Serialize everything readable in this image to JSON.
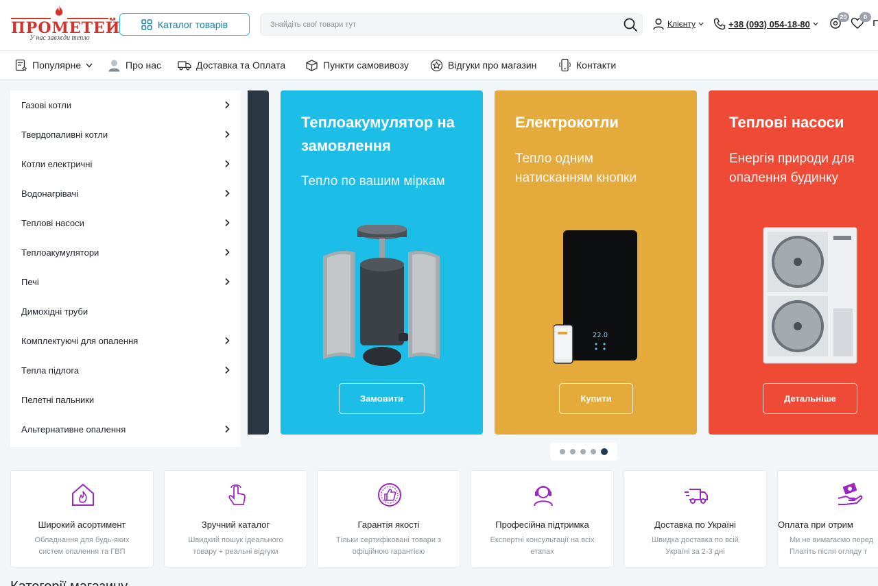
{
  "header": {
    "logo_brand": "ПРОМЕТЕЙ",
    "logo_tagline": "У нас завжди тепло",
    "catalog_button": "Каталог товарів",
    "search_placeholder": "Знайдіть свої товари тут",
    "client_label": "Клієнту",
    "phone": "+38 (093) 054-18-80",
    "compare_count": "20",
    "wishlist_count": "0"
  },
  "nav": {
    "items": [
      {
        "label": "Популярне",
        "icon": "star-list-icon"
      },
      {
        "label": "Про нас",
        "icon": "person-icon"
      },
      {
        "label": "Доставка та Оплата",
        "icon": "truck-icon"
      },
      {
        "label": "Пункти самовивозу",
        "icon": "box-icon"
      },
      {
        "label": "Відгуки про магазин",
        "icon": "star-badge-icon"
      },
      {
        "label": "Контакти",
        "icon": "phone-icon"
      }
    ]
  },
  "sidebar": {
    "items": [
      {
        "label": "Газові котли",
        "has_sub": true
      },
      {
        "label": "Твердопаливні котли",
        "has_sub": true
      },
      {
        "label": "Котли електричні",
        "has_sub": true
      },
      {
        "label": "Водонагрівачі",
        "has_sub": true
      },
      {
        "label": "Теплові насоси",
        "has_sub": true
      },
      {
        "label": "Теплоакумулятори",
        "has_sub": true
      },
      {
        "label": "Печі",
        "has_sub": true
      },
      {
        "label": "Димохідні труби",
        "has_sub": false
      },
      {
        "label": "Комплектуючі для опалення",
        "has_sub": true
      },
      {
        "label": "Тепла підлога",
        "has_sub": true
      },
      {
        "label": "Пелетні пальники",
        "has_sub": false
      },
      {
        "label": "Альтернативне опалення",
        "has_sub": true
      }
    ]
  },
  "banners": [
    {
      "title_line1": "Теплоакумулятор на",
      "title_line2": "замовлення",
      "subtitle_line1": "Тепло по вашим міркам",
      "subtitle_line2": "",
      "button": "Замовити",
      "color": "#1cbde6"
    },
    {
      "title_line1": "Електрокотли",
      "title_line2": "",
      "subtitle_line1": "Тепло одним",
      "subtitle_line2": "натисканням кнопки",
      "button": "Купити",
      "color": "#e4ab3c",
      "display_text": "22.0"
    },
    {
      "title_line1": "Теплові насоси",
      "title_line2": "",
      "subtitle_line1": "Енергія природи для",
      "subtitle_line2": "опалення будинку",
      "button": "Детальніше",
      "color": "#ef4a35"
    }
  ],
  "carousel": {
    "dots": 5,
    "active_index": 4
  },
  "features": [
    {
      "title": "Широкий асортимент",
      "desc_line1": "Обладнання для будь-яких",
      "desc_line2": "систем опалення та ГВП",
      "icon": "house-flame-icon"
    },
    {
      "title": "Зручний каталог",
      "desc_line1": "Швидкий пошук ідеального",
      "desc_line2": "товару + реальні відгуки",
      "icon": "pointer-hand-icon"
    },
    {
      "title": "Гарантія якості",
      "desc_line1": "Тільки сертифіковані товари з",
      "desc_line2": "офіційною гарантією",
      "icon": "thumbs-up-badge-icon"
    },
    {
      "title": "Професійна підтримка",
      "desc_line1": "Експертні консультації на всіх",
      "desc_line2": "етапах",
      "icon": "headset-icon"
    },
    {
      "title": "Доставка по Україні",
      "desc_line1": "Швидка доставка по всій",
      "desc_line2": "Україні за 2-3 дні",
      "icon": "truck-fast-icon"
    },
    {
      "title": "Оплата при отрим",
      "desc_line1": "Ми не вимагаємо перед",
      "desc_line2": "Платіть після огляду т",
      "icon": "hand-money-icon"
    }
  ],
  "section_title": "Категорії магазину",
  "colors": {
    "accent_blue": "#2fb5e0",
    "brand_red": "#d7322a",
    "feature_purple": "#9b27c4"
  }
}
